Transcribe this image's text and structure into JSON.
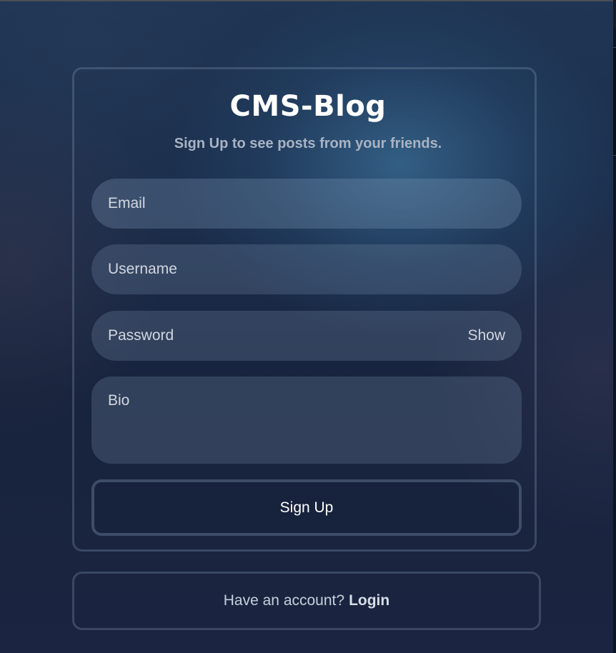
{
  "brand": {
    "title": "CMS-Blog"
  },
  "subtitle": "Sign Up to see posts from your friends.",
  "form": {
    "email": {
      "placeholder": "Email",
      "value": ""
    },
    "username": {
      "placeholder": "Username",
      "value": ""
    },
    "password": {
      "placeholder": "Password",
      "value": "",
      "toggle_label": "Show"
    },
    "bio": {
      "placeholder": "Bio",
      "value": ""
    },
    "submit_label": "Sign Up"
  },
  "footer": {
    "prompt": "Have an account?",
    "login_label": "Login"
  }
}
